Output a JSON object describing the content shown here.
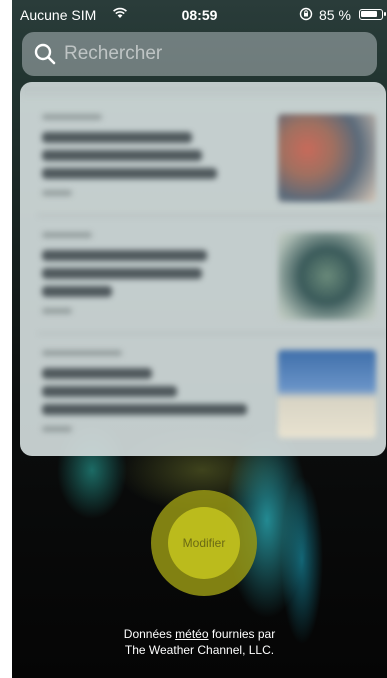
{
  "status_bar": {
    "carrier": "Aucune SIM",
    "time": "08:59",
    "battery": "85 %",
    "battery_level": 0.85
  },
  "search": {
    "placeholder": "Rechercher"
  },
  "modifier_button": {
    "label": "Modifier"
  },
  "footer": {
    "prefix": "Données ",
    "link": "météo",
    "suffix": " fournies par",
    "line2": "The Weather Channel, LLC."
  }
}
